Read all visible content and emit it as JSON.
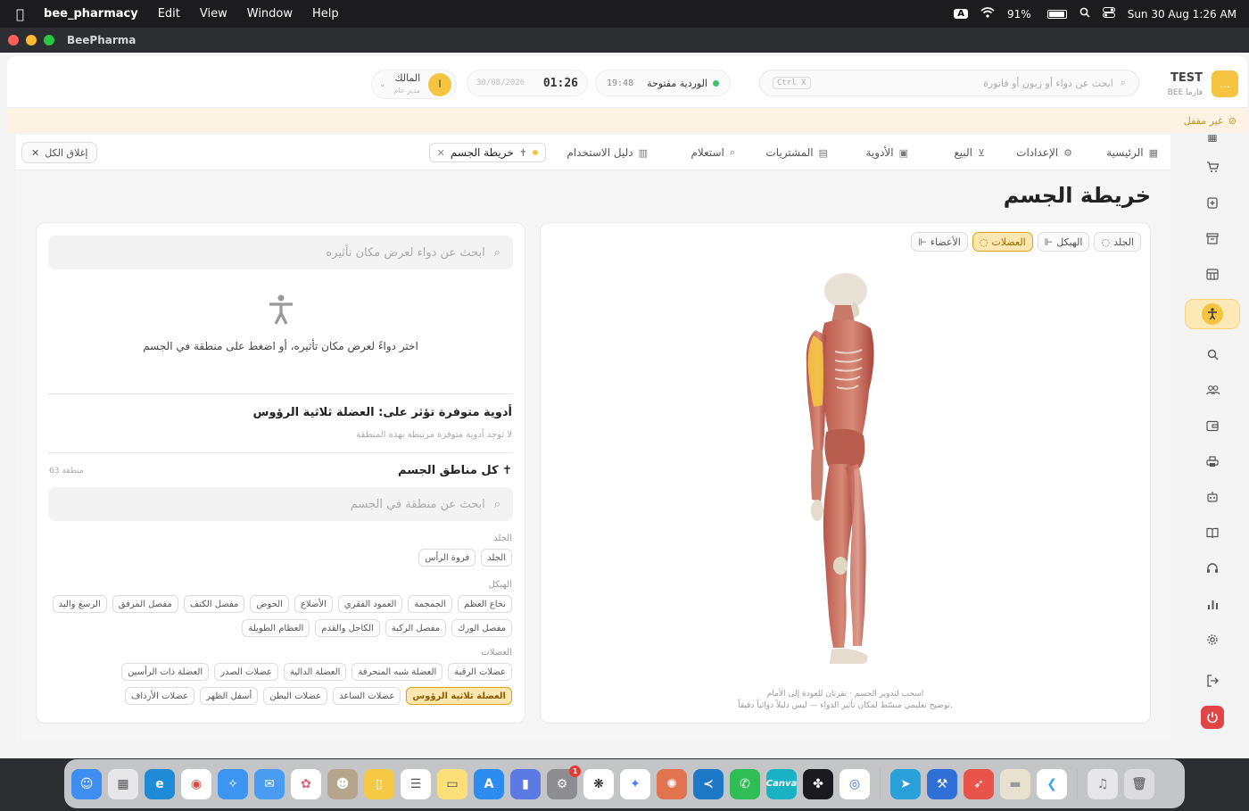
{
  "menubar": {
    "app_name": "bee_pharmacy",
    "menus": [
      "Edit",
      "View",
      "Window",
      "Help"
    ],
    "input_badge": "A",
    "battery": "91%",
    "datetime": "Sun 30 Aug  1:26 AM"
  },
  "window": {
    "title": "BeePharma"
  },
  "header": {
    "brand_name": "TEST",
    "brand_sub": "BEE فارما",
    "search_placeholder": "ابحث عن دواء أو زبون أو فاتورة",
    "search_kbd": "Ctrl X",
    "shift_label": "الوردية مفتوحة",
    "shift_time": "19:48",
    "clock_time": "01:26",
    "clock_date": "30/08/2026",
    "user_initial": "ا",
    "user_name": "المالك",
    "user_role": "مدير عام"
  },
  "banner": {
    "text": "غير مقفل"
  },
  "tabs": {
    "items": [
      {
        "label": "الرئيسية",
        "icon": "▦"
      },
      {
        "label": "الإعدادات",
        "icon": "⚙"
      },
      {
        "label": "البيع",
        "icon": "🛒"
      },
      {
        "label": "الأدوية",
        "icon": "▣"
      },
      {
        "label": "المشتريات",
        "icon": "▤"
      },
      {
        "label": "استعلام",
        "icon": "⌕"
      },
      {
        "label": "دليل الاستخدام",
        "icon": "▥"
      }
    ],
    "open_tab": "خريطة الجسم",
    "close_all": "إغلاق الكل"
  },
  "page": {
    "title": "خريطة الجسم"
  },
  "viewer": {
    "layers": [
      {
        "label": "الجلد",
        "active": false
      },
      {
        "label": "الهيكل",
        "active": false
      },
      {
        "label": "العضلات",
        "active": true
      },
      {
        "label": "الأعضاء",
        "active": false
      }
    ],
    "hint_1": "اسحب لتدوير الجسم · نقرتان للعودة إلى الأمام",
    "hint_2": "توضيح تعليمي مبسّط لمكان تأثير الدواء — ليس دليلاً دوائياً دقيقاً."
  },
  "side": {
    "drug_search_placeholder": "ابحث عن دواء لعرض مكان تأثيره",
    "empty_text": "اختر دواءً لعرض مكان تأثيره، أو اضغط على منطقة في الجسم",
    "affecting_title": "أدوية متوفرة تؤثر على: العضلة ثلاثية الرؤوس",
    "affecting_empty": "لا توجد أدوية متوفرة مرتبطة بهذه المنطقة",
    "all_regions_title": "كل مناطق الجسم",
    "regions_count": "63 منطقة",
    "region_search_placeholder": "ابحث عن منطقة في الجسم",
    "groups": [
      {
        "name": "الجلد",
        "chips": [
          "الجلد",
          "فروة الرأس"
        ]
      },
      {
        "name": "الهيكل",
        "chips": [
          "نخاع العظم",
          "الجمجمة",
          "العمود الفقري",
          "الأضلاع",
          "الحوض",
          "مفصل الكتف",
          "مفصل المرفق",
          "الرسغ واليد",
          "مفصل الورك",
          "مفصل الركبة",
          "الكاحل والقدم",
          "العظام الطويلة"
        ]
      },
      {
        "name": "العضلات",
        "chips": [
          "عضلات الرقبة",
          "العضلة شبه المنحرفة",
          "العضلة الدالية",
          "عضلات الصدر",
          "العضلة ذات الرأسين",
          "العضلة ثلاثية الرؤوس",
          "عضلات الساعد",
          "عضلات البطن",
          "أسفل الظهر",
          "عضلات الأرداف"
        ],
        "selected": "العضلة ثلاثية الرؤوس"
      }
    ]
  },
  "colors": {
    "accent": "#f5c542",
    "accent_soft": "#fde7b0",
    "danger": "#e24545"
  }
}
